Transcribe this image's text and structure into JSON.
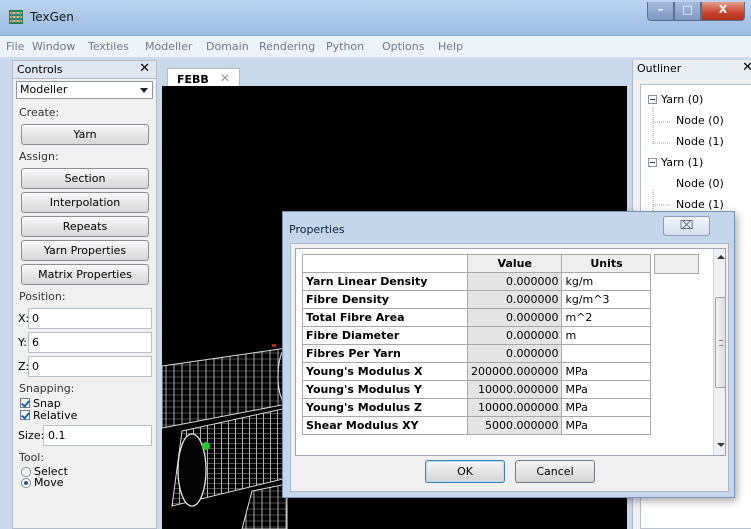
{
  "window": {
    "title": "TexGen",
    "controls": [
      "–",
      "□",
      "X"
    ]
  },
  "menubar": {
    "items": [
      "File",
      "Window",
      "Textiles",
      "Modeller",
      "Domain",
      "Rendering",
      "Python",
      "Options",
      "Help"
    ]
  },
  "controls_panel": {
    "title": "Controls",
    "close": "✕",
    "mode": "Modeller",
    "create_label": "Create:",
    "yarn_button": "Yarn",
    "assign_label": "Assign:",
    "assign_buttons": [
      "Section",
      "Interpolation",
      "Repeats",
      "Yarn Properties",
      "Matrix Properties"
    ],
    "position_label": "Position:",
    "position": {
      "x_label": "X:",
      "x": "0",
      "y_label": "Y:",
      "y": "6",
      "z_label": "Z:",
      "z": "0"
    },
    "snapping_label": "Snapping:",
    "snap_label": "Snap",
    "relative_label": "Relative",
    "size_label": "Size:",
    "size": "0.1",
    "tool_label": "Tool:",
    "tool_select": "Select",
    "tool_move": "Move"
  },
  "document_tab": {
    "label": "FEBB",
    "close": "✕"
  },
  "outliner": {
    "title": "Outliner",
    "close": "✕",
    "tree": [
      {
        "label": "Yarn (0)",
        "children": [
          "Node (0)",
          "Node (1)"
        ]
      },
      {
        "label": "Yarn (1)",
        "children": [
          "Node (0)",
          "Node (1)"
        ]
      }
    ]
  },
  "properties_dialog": {
    "title": "Properties",
    "close": "⌧",
    "columns": [
      "Value",
      "Units"
    ],
    "rows": [
      {
        "name": "Yarn Linear Density",
        "value": "0.000000",
        "units": "kg/m"
      },
      {
        "name": "Fibre Density",
        "value": "0.000000",
        "units": "kg/m^3"
      },
      {
        "name": "Total Fibre Area",
        "value": "0.000000",
        "units": "m^2"
      },
      {
        "name": "Fibre Diameter",
        "value": "0.000000",
        "units": "m"
      },
      {
        "name": "Fibres Per Yarn",
        "value": "0.000000",
        "units": ""
      },
      {
        "name": "Young's Modulus X",
        "value": "200000.000000",
        "units": "MPa"
      },
      {
        "name": "Young's Modulus Y",
        "value": "10000.000000",
        "units": "MPa"
      },
      {
        "name": "Young's Modulus Z",
        "value": "10000.000000",
        "units": "MPa"
      },
      {
        "name": "Shear Modulus XY",
        "value": "5000.000000",
        "units": "MPa"
      }
    ],
    "ok_label": "OK",
    "cancel_label": "Cancel"
  },
  "colors": {
    "viewport_bg": "#000000",
    "yarn_wire": "#d8d8d8",
    "node_marker": "#22cc22",
    "dialog_frame": "#c3d6ec"
  }
}
